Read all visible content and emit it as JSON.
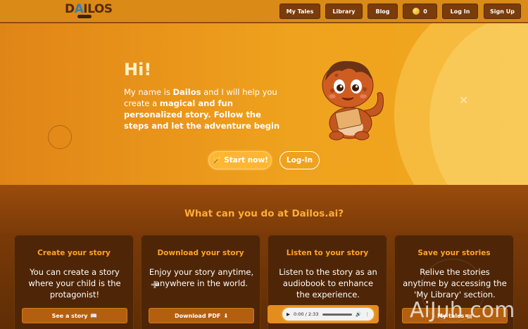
{
  "header": {
    "logo": "DAILOS",
    "nav": [
      {
        "label": "My Tales"
      },
      {
        "label": "Library"
      },
      {
        "label": "Blog"
      }
    ],
    "coins": "0",
    "login_label": "Log In",
    "signup_label": "Sign Up"
  },
  "hero": {
    "title": "Hi!",
    "intro_plain_1": "My name is ",
    "intro_bold_1": "Dailos",
    "intro_plain_2": " and I will help you create a ",
    "intro_bold_2": "magical and fun personalized story. Follow the steps and let the adventure begin",
    "start_label": "Start now!",
    "login_label": "Log-In"
  },
  "features": {
    "title": "What can you do at Dailos.ai?",
    "cards": [
      {
        "title": "Create your story",
        "text": "You can create a story where your child is the protagonist!",
        "button": "See a story",
        "button_icon": "book-icon"
      },
      {
        "title": "Download your story",
        "text": "Enjoy your story anytime, anywhere in the world.",
        "button": "Download PDF",
        "button_icon": "download-icon"
      },
      {
        "title": "Listen to your story",
        "text": "Listen to the story as an audiobook to enhance the experience.",
        "audio_time": "0:00 / 2:33"
      },
      {
        "title": "Save your stories",
        "text": "Relive the stories anytime by accessing the 'My Library' section.",
        "button": "My tales",
        "button_icon": "library-icon"
      }
    ]
  },
  "watermark": "AiJuh.com",
  "colors": {
    "header_bg": "#d98a17",
    "hero_bg": "#efa21d",
    "accent_orange": "#ffa42a",
    "card_bg": "#4e2506",
    "section_bg": "#7a3a08"
  }
}
